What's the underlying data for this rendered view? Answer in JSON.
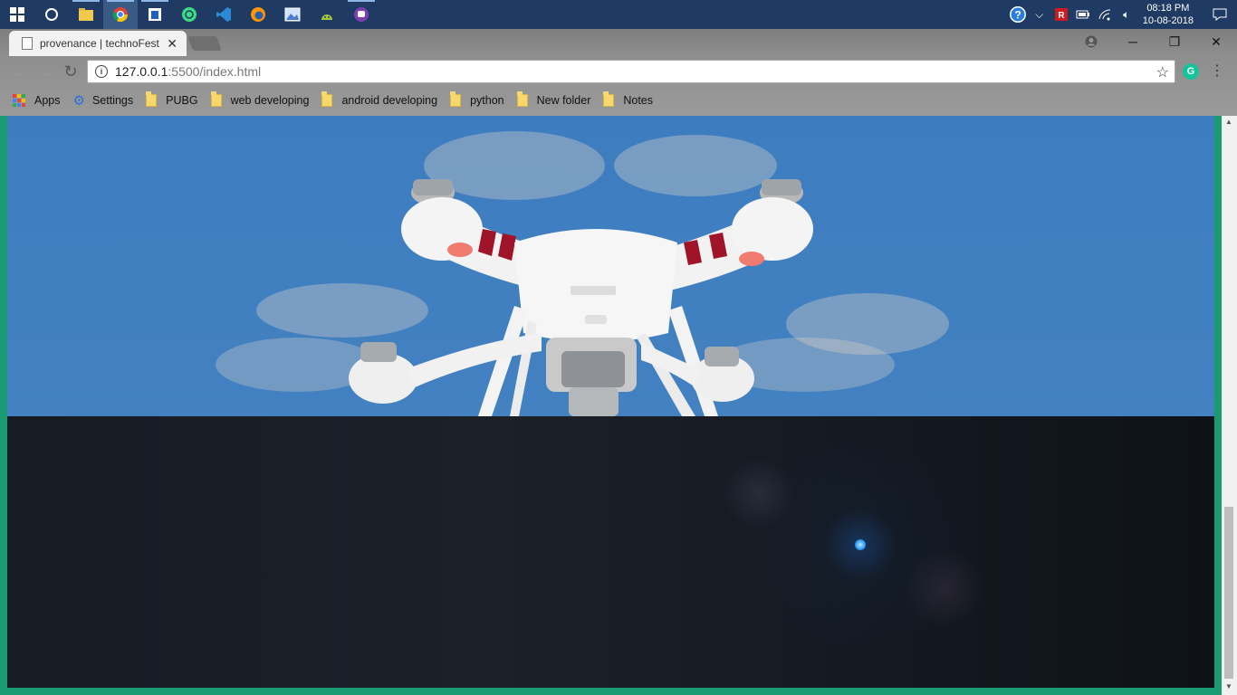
{
  "taskbar": {
    "icons": [
      "windows-start-icon",
      "cortana-icon",
      "file-explorer-icon",
      "chrome-icon",
      "store-icon",
      "android-studio-app-icon",
      "vscode-icon",
      "firefox-icon",
      "photos-icon",
      "android-icon",
      "app-icon"
    ],
    "time": "08:18 PM",
    "date": "10-08-2018"
  },
  "browser": {
    "tab_title": "provenance | technoFest",
    "url_host": "127.0.0.1",
    "url_rest": ":5500/index.html",
    "bookmarks": [
      {
        "label": "Apps",
        "icon": "apps-icon"
      },
      {
        "label": "Settings",
        "icon": "gear-icon"
      },
      {
        "label": "PUBG",
        "icon": "folder-icon"
      },
      {
        "label": "web developing",
        "icon": "folder-icon"
      },
      {
        "label": "android developing",
        "icon": "folder-icon"
      },
      {
        "label": "python",
        "icon": "folder-icon"
      },
      {
        "label": "New folder",
        "icon": "folder-icon"
      },
      {
        "label": "Notes",
        "icon": "folder-icon"
      }
    ]
  },
  "colors": {
    "page_border": "#1a9a72",
    "sky": "#3d7dbf",
    "dark_section": "#141a22",
    "taskbar": "#1f3a63"
  }
}
